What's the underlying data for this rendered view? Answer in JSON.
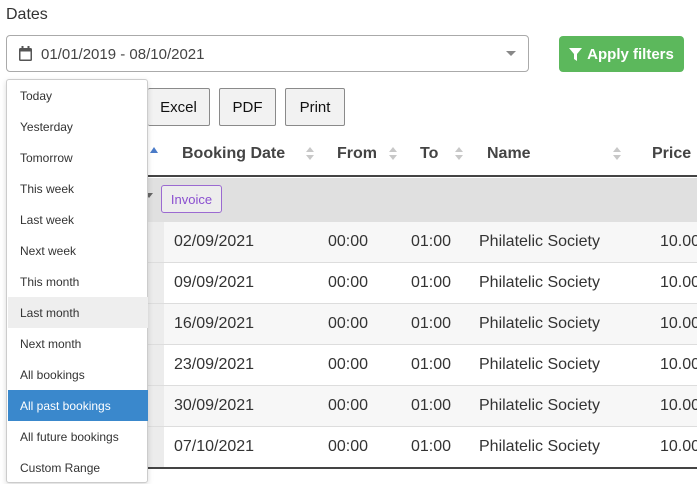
{
  "filters": {
    "dates_label": "Dates",
    "date_range": "01/01/2019 - 08/10/2021",
    "apply_label": "Apply filters"
  },
  "export": {
    "excel": "Excel",
    "pdf": "PDF",
    "print": "Print"
  },
  "table": {
    "columns": [
      "Booking Date",
      "From",
      "To",
      "Name",
      "Price"
    ],
    "group_badge": "Invoice",
    "rows": [
      [
        "02/09/2021",
        "00:00",
        "01:00",
        "Philatelic Society",
        "10.00"
      ],
      [
        "09/09/2021",
        "00:00",
        "01:00",
        "Philatelic Society",
        "10.00"
      ],
      [
        "16/09/2021",
        "00:00",
        "01:00",
        "Philatelic Society",
        "10.00"
      ],
      [
        "23/09/2021",
        "00:00",
        "01:00",
        "Philatelic Society",
        "10.00"
      ],
      [
        "30/09/2021",
        "00:00",
        "01:00",
        "Philatelic Society",
        "10.00"
      ],
      [
        "07/10/2021",
        "00:00",
        "01:00",
        "Philatelic Society",
        "10.00"
      ]
    ]
  },
  "range_menu": {
    "items": [
      "Today",
      "Yesterday",
      "Tomorrow",
      "This week",
      "Last week",
      "Next week",
      "This month",
      "Last month",
      "Next month",
      "All bookings",
      "All past bookings",
      "All future bookings",
      "Custom Range"
    ],
    "hovered": "Last month",
    "selected": "All past bookings"
  },
  "colors": {
    "accent": "#3a88cc",
    "apply": "#5cb85c",
    "badge": "#8a4fd0"
  }
}
